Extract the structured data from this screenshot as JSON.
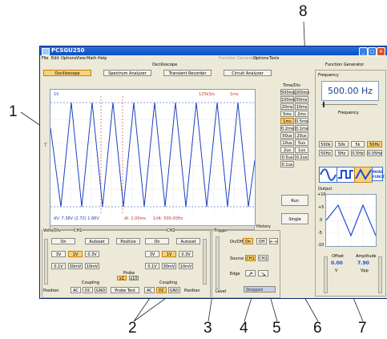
{
  "callouts": [
    "1",
    "2",
    "3",
    "4",
    "5",
    "6",
    "7",
    "8"
  ],
  "window": {
    "title": "PCSGU250",
    "menu": [
      "File",
      "Edit",
      "Options",
      "View",
      "Math",
      "Help"
    ],
    "menu_right": [
      "Function Generator",
      "Options",
      "Tools"
    ],
    "controls": {
      "minimize": "_",
      "maximize": "□",
      "close": "✕"
    }
  },
  "oscilloscope": {
    "section_label": "Oscilloscope",
    "tabs": [
      "Oscilloscope",
      "Spectrum Analyzer",
      "Transient Recorder",
      "Circuit Analyzer"
    ],
    "readout_ch": "1V",
    "readout_rate": "125kS/s",
    "readout_time": "1ms",
    "marker": "T",
    "bottom_dv": "dV: 7.38V (2.72) 1.66V",
    "bottom_dt": "dt: 2.00ms",
    "bottom_freq": "1/dt: 500.00Hz",
    "history_label": "History"
  },
  "timebase": {
    "label": "Time/Div",
    "buttons": [
      "500ms",
      "200ms",
      "100ms",
      "50ms",
      "20ms",
      "10ms",
      "5ms",
      "2ms",
      "1ms",
      "0.5ms",
      "0.2ms",
      "0.1ms",
      "50us",
      "20us",
      "10us",
      "5us",
      "2us",
      "1us",
      "0.5us",
      "0.2us",
      "0.1us"
    ],
    "selected": "1ms"
  },
  "run_label": "Run",
  "single_label": "Single",
  "volts": {
    "label": "Volts/Div",
    "ch1_label": "CH1",
    "ch2_label": "CH2",
    "ch1_on": "On",
    "ch1_autoset": "Autoset",
    "ch1_row1": [
      "3V",
      "1V",
      "0.3V"
    ],
    "ch1_row2": [
      "0.1V",
      "30mV",
      "10mV"
    ],
    "positive": "Positive",
    "ch2_on": "On",
    "ch2_autoset": "Autoset",
    "ch2_row1": [
      "3V",
      "1V",
      "0.3V"
    ],
    "ch2_row2": [
      "0.1V",
      "30mV",
      "10mV"
    ],
    "probe_label": "Probe",
    "probe_ch1": "x1",
    "probe_ch2": "x10",
    "coupling_label": "Coupling",
    "coupling_ch1": [
      "AC",
      "DC",
      "GND"
    ],
    "coupling_ch2": [
      "AC",
      "DC",
      "GND"
    ],
    "probe_test": "Probe Test",
    "position_label": "Position",
    "position_label2": "Position"
  },
  "trigger": {
    "label": "Trigger",
    "onoff_label": "On/Off",
    "on_btn": "On",
    "off_btn": "Off",
    "arrows": "⇤⇥",
    "source_label": "Source",
    "source_opts": [
      "CH1",
      "CH2"
    ],
    "edge_label": "Edge",
    "status": "Stopped",
    "level_label": "Level"
  },
  "function_generator": {
    "section_label": "Function Generator",
    "frequency_label": "Frequency",
    "frequency_value": "500.00 Hz",
    "frequency_caption": "Frequency",
    "range_row1": [
      "500k",
      "50k",
      "5k",
      "50Hz"
    ],
    "range_row2": [
      "50Hz",
      "5Hz",
      "0.5Hz",
      "0.05Hz"
    ],
    "selected_range": "50Hz",
    "more_label": "MORE FUNCT.",
    "output_label": "Output",
    "axis": [
      "+10",
      "+5",
      "0",
      "-5",
      "-10"
    ],
    "offset_label": "Offset",
    "offset_value": "0.00",
    "offset_unit": "V",
    "amplitude_label": "Amplitude",
    "amplitude_value": "7.90",
    "amplitude_unit": "Vpp"
  }
}
